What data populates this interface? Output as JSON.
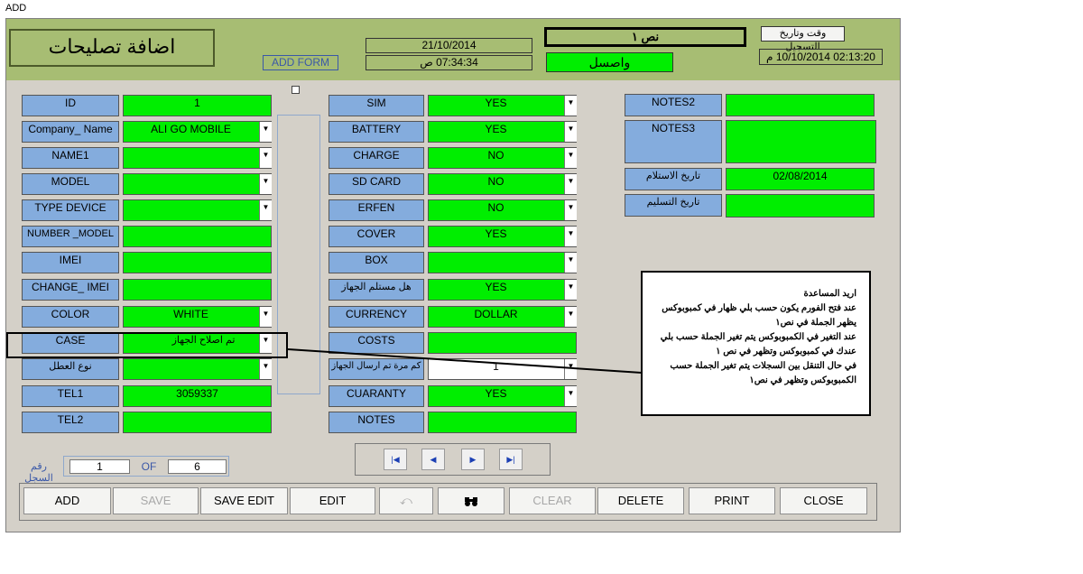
{
  "window": {
    "title": "ADD"
  },
  "header": {
    "form_title": "اضافة تصليحات",
    "form_label": "ADD FORM",
    "date": "21/10/2014",
    "time": "07:34:34 ص",
    "text_box_1": "نص ١",
    "status": "واصسل",
    "record_datetime_label": "وقت وتاريخ التسجيل",
    "record_datetime": "02:13:20 10/10/2014 م"
  },
  "col1": {
    "id": {
      "label": "ID",
      "value": "1"
    },
    "company_name": {
      "label": "Company_ Name",
      "value": "ALI GO MOBILE"
    },
    "name1": {
      "label": "NAME1",
      "value": ""
    },
    "model": {
      "label": "MODEL",
      "value": ""
    },
    "type_device": {
      "label": "TYPE DEVICE",
      "value": ""
    },
    "number_model": {
      "label": "NUMBER _MODEL",
      "value": ""
    },
    "imei": {
      "label": "IMEI",
      "value": ""
    },
    "change_imei": {
      "label": "CHANGE_ IMEI",
      "value": ""
    },
    "color": {
      "label": "COLOR",
      "value": "WHITE"
    },
    "case": {
      "label": "CASE",
      "value": "تم اصلاح الجهاز"
    },
    "fault_type": {
      "label": "نوع العطل",
      "value": ""
    },
    "tel1": {
      "label": "TEL1",
      "value": "3059337"
    },
    "tel2": {
      "label": "TEL2",
      "value": ""
    }
  },
  "col2": {
    "sim": {
      "label": "SIM",
      "value": "YES"
    },
    "battery": {
      "label": "BATTERY",
      "value": "YES"
    },
    "charge": {
      "label": "CHARGE",
      "value": "NO"
    },
    "sd_card": {
      "label": "SD CARD",
      "value": "NO"
    },
    "erfen": {
      "label": "ERFEN",
      "value": "NO"
    },
    "cover": {
      "label": "COVER",
      "value": "YES"
    },
    "box": {
      "label": "BOX",
      "value": ""
    },
    "device_received": {
      "label": "هل مستلم الجهاز",
      "value": "YES"
    },
    "currency": {
      "label": "CURRENCY",
      "value": "DOLLAR"
    },
    "costs": {
      "label": "COSTS",
      "value": ""
    },
    "times_sent": {
      "label": "كم مرة تم ارسال الجهاز",
      "value": "1"
    },
    "cuaranty": {
      "label": "CUARANTY",
      "value": "YES"
    },
    "notes": {
      "label": "NOTES",
      "value": ""
    }
  },
  "col3": {
    "notes2": {
      "label": "NOTES2",
      "value": ""
    },
    "notes3": {
      "label": "NOTES3",
      "value": ""
    },
    "receive_date": {
      "label": "تاريخ الاستلام",
      "value": "02/08/2014"
    },
    "delivery_date": {
      "label": "تاريخ التسليم",
      "value": ""
    }
  },
  "annotation": {
    "lines": [
      "اريد المساعدة",
      "عند فتح الفورم يكون حسب بلي ظهار في كمبوبوكس",
      "يظهر الجملة في نص١",
      "عند التغير في الكمبوبوكس  يتم تغير الجملة حسب بلي",
      "عندك في كمبوبوكس وتظهر في نص ١",
      "في حال التنقل بين السجلات يتم تغير الجملة حسب",
      "الكمبوبوكس   وتظهر في نص١"
    ]
  },
  "record_nav": {
    "label": "رقم السجل",
    "current": "1",
    "of_label": "OF",
    "total": "6"
  },
  "buttons": {
    "add": "ADD",
    "save": "SAVE",
    "save_edit": "SAVE EDIT",
    "edit": "EDIT",
    "undo_icon": "undo-icon",
    "find_icon": "binoculars-icon",
    "clear": "CLEAR",
    "delete": "DELETE",
    "print": "PRINT",
    "close": "CLOSE"
  }
}
